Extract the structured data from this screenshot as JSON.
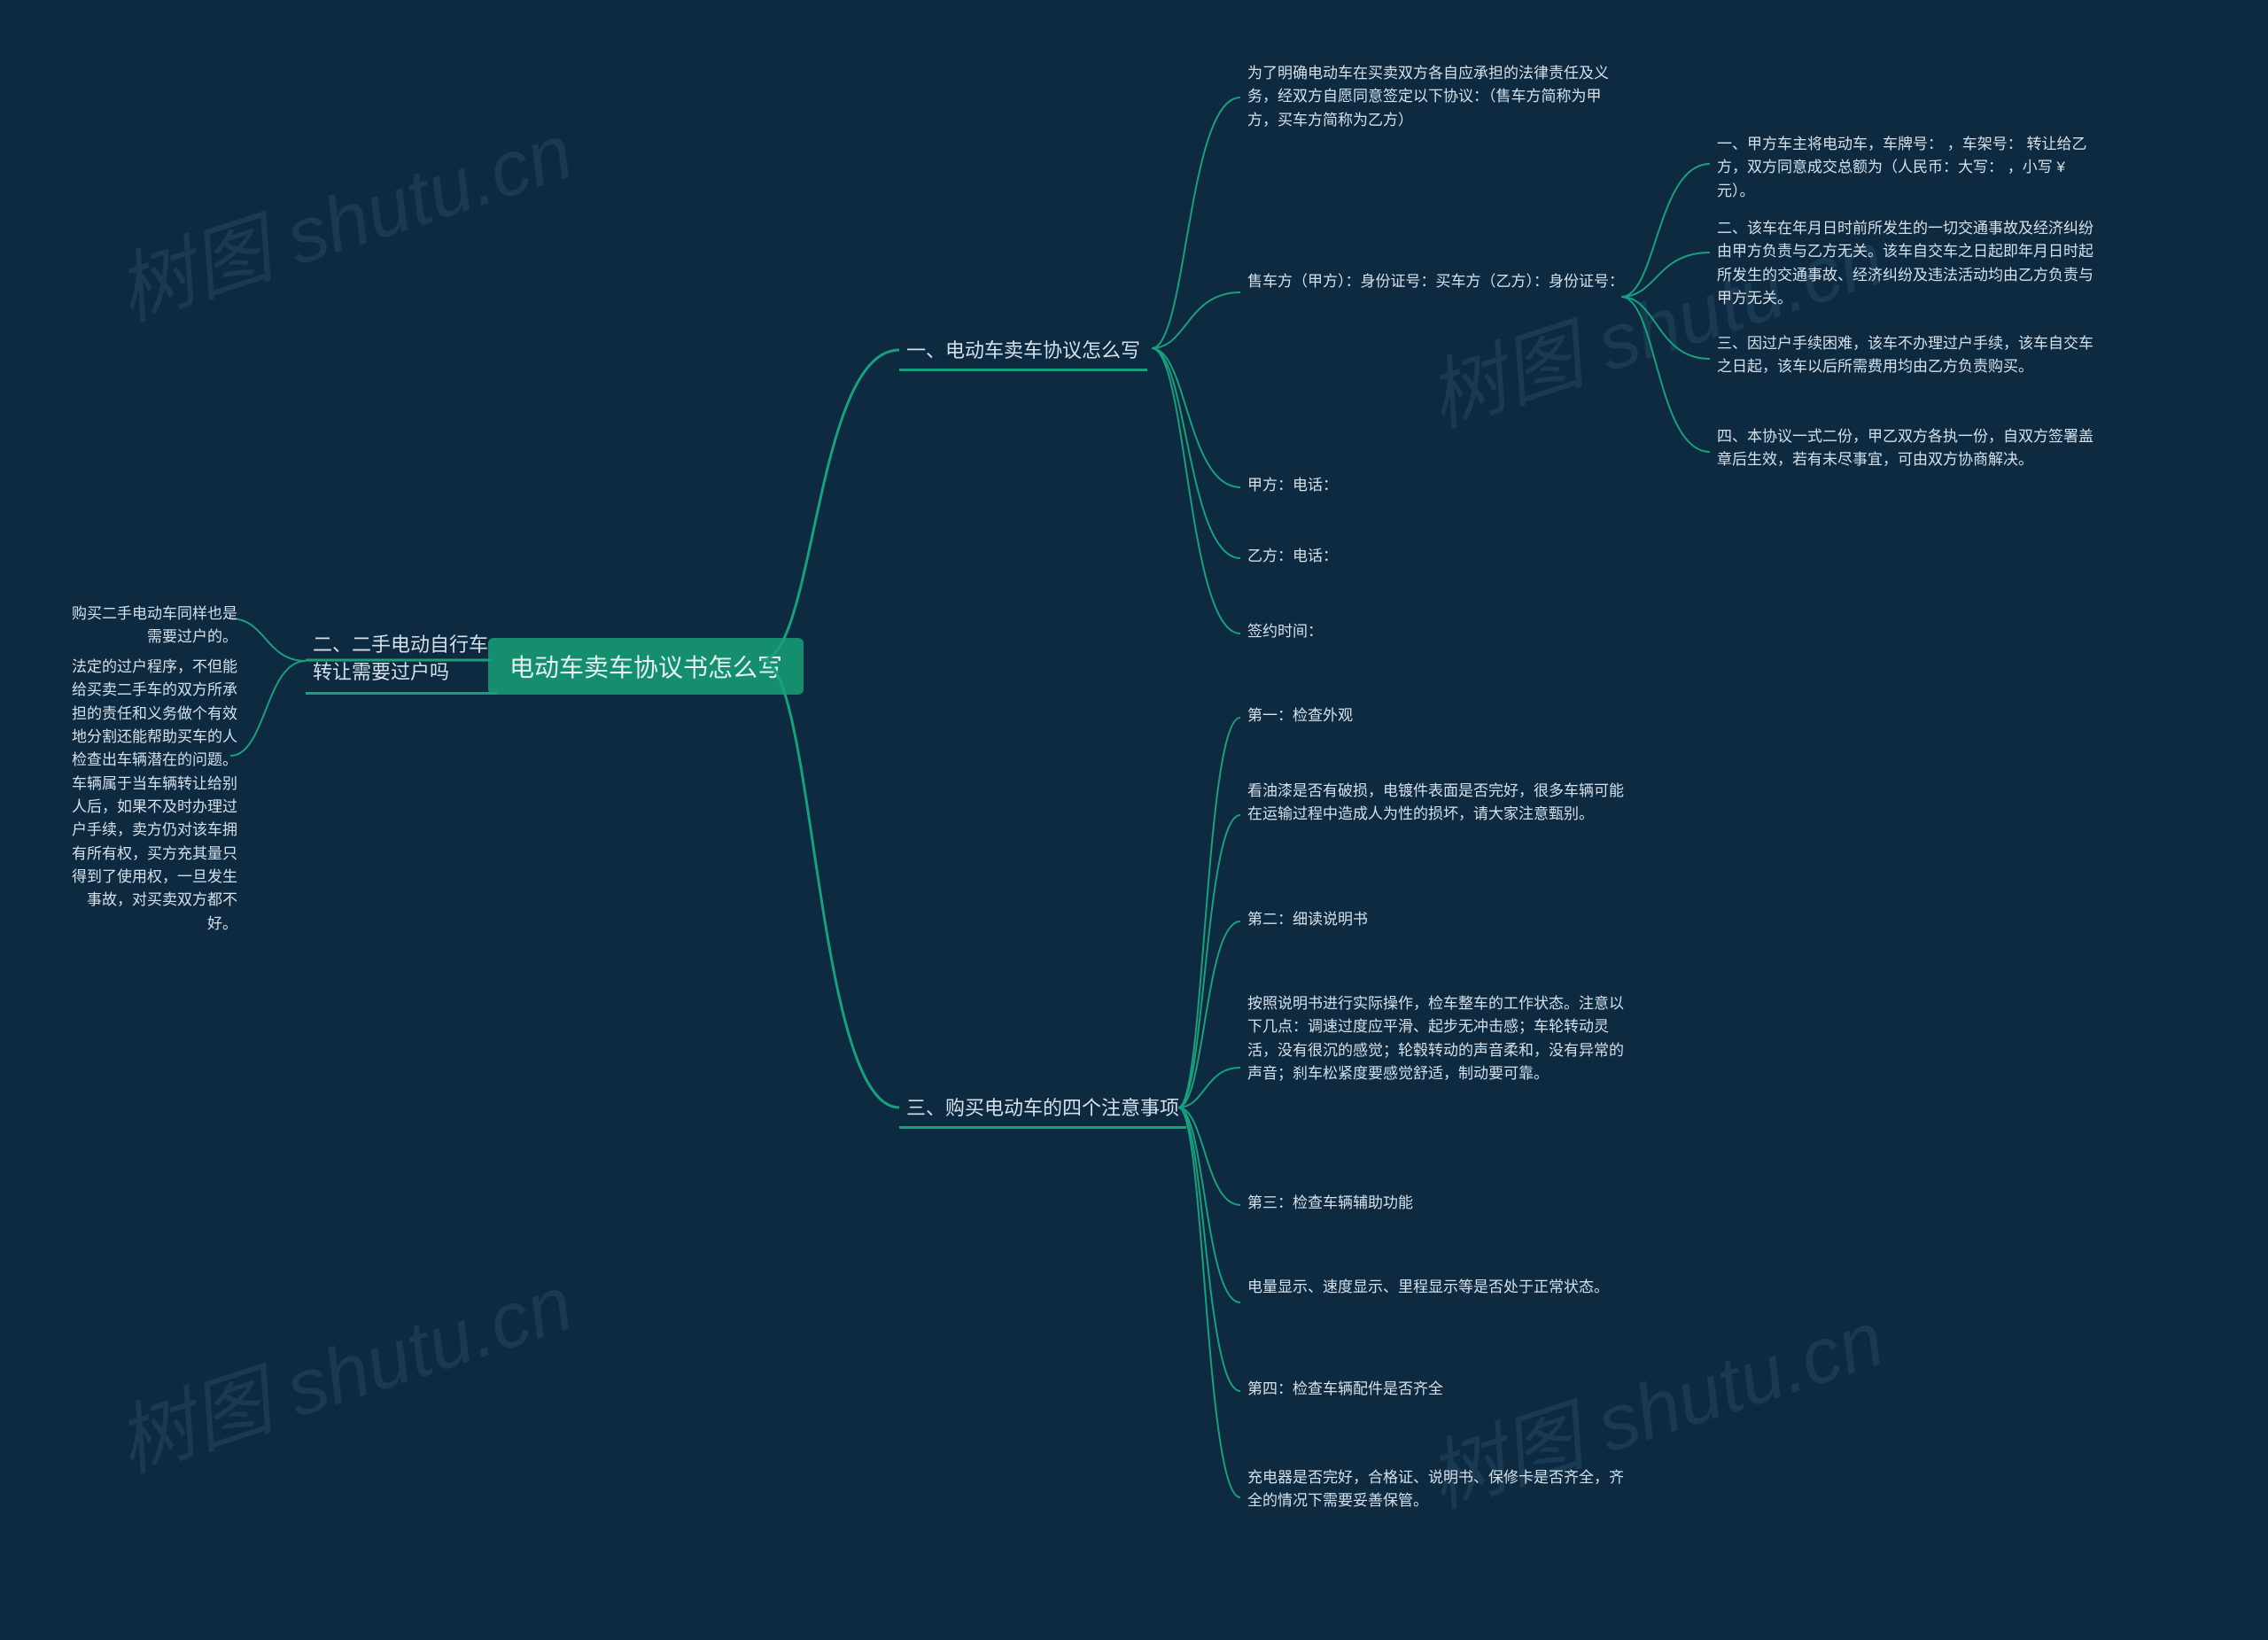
{
  "watermark": "树图 shutu.cn",
  "root": {
    "label": "电动车卖车协议书怎么写"
  },
  "branch1": {
    "label": "一、电动车卖车协议怎么写",
    "n1": "为了明确电动车在买卖双方各自应承担的法律责任及义务，经双方自愿同意签定以下协议：（售车方简称为甲方，买车方简称为乙方）",
    "n2": "售车方（甲方）：身份证号：买车方（乙方）：身份证号：",
    "n2c1": "一、甲方车主将电动车，车牌号：  ，车架号：  转让给乙方，双方同意成交总额为（人民币：大写：  ，小写 ¥ 元）。",
    "n2c2": "二、该车在年月日时前所发生的一切交通事故及经济纠纷由甲方负责与乙方无关。该车自交车之日起即年月日时起所发生的交通事故、经济纠纷及违法活动均由乙方负责与甲方无关。",
    "n2c3": "三、因过户手续困难，该车不办理过户手续，该车自交车之日起，该车以后所需费用均由乙方负责购买。",
    "n2c4": "四、本协议一式二份，甲乙双方各执一份，自双方签署盖章后生效，若有未尽事宜，可由双方协商解决。",
    "n3": "甲方：电话：",
    "n4": "乙方：电话：",
    "n5": "签约时间："
  },
  "branch2": {
    "label": "二、二手电动自行车转让需要过户吗",
    "n1": "购买二手电动车同样也是需要过户的。",
    "n2": "法定的过户程序，不但能给买卖二手车的双方所承担的责任和义务做个有效地分割还能帮助买车的人检查出车辆潜在的问题。车辆属于当车辆转让给别人后，如果不及时办理过户手续，卖方仍对该车拥有所有权，买方充其量只得到了使用权，一旦发生事故，对买卖双方都不好。"
  },
  "branch3": {
    "label": "三、购买电动车的四个注意事项",
    "n1": "第一：检查外观",
    "n2": "看油漆是否有破损，电镀件表面是否完好，很多车辆可能在运输过程中造成人为性的损坏，请大家注意甄别。",
    "n3": "第二：细读说明书",
    "n4": "按照说明书进行实际操作，检车整车的工作状态。注意以下几点：调速过度应平滑、起步无冲击感；车轮转动灵活，没有很沉的感觉；轮毂转动的声音柔和，没有异常的声音；刹车松紧度要感觉舒适，制动要可靠。",
    "n5": "第三：检查车辆辅助功能",
    "n6": "电量显示、速度显示、里程显示等是否处于正常状态。",
    "n7": "第四：检查车辆配件是否齐全",
    "n8": "充电器是否完好，合格证、说明书、保修卡是否齐全，齐全的情况下需要妥善保管。"
  }
}
